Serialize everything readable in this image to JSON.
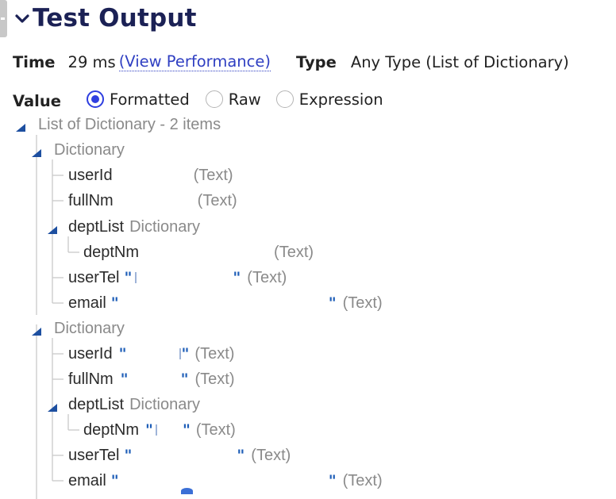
{
  "header": {
    "title": "Test Output"
  },
  "meta": {
    "time_label": "Time",
    "time_value": "29 ms",
    "perf_link": "(View Performance)",
    "type_label": "Type",
    "type_value": "Any Type (List of Dictionary)"
  },
  "value": {
    "label": "Value",
    "options": [
      {
        "label": "Formatted",
        "selected": true
      },
      {
        "label": "Raw",
        "selected": false
      },
      {
        "label": "Expression",
        "selected": false
      }
    ]
  },
  "tree": {
    "root": "List of Dictionary - 2 items",
    "dict_label": "Dictionary",
    "type_text": "(Text)",
    "quote": "\"",
    "items": [
      {
        "userId": "userId",
        "fullNm": "fullNm",
        "deptList": "deptList",
        "deptNm": "deptNm",
        "userTel": "userTel",
        "email": "email"
      },
      {
        "userId": "userId",
        "fullNm": "fullNm",
        "deptList": "deptList",
        "deptNm": "deptNm",
        "userTel": "userTel",
        "email": "email"
      }
    ]
  },
  "colors": {
    "title": "#1b2155",
    "link": "#2f3fc2",
    "radio_selected": "#2f3fe0",
    "quote": "#1f5fb8",
    "type_hint": "#8a8a8a",
    "tree_line": "#c9c9c9",
    "toggle": "#1d4fa0"
  }
}
